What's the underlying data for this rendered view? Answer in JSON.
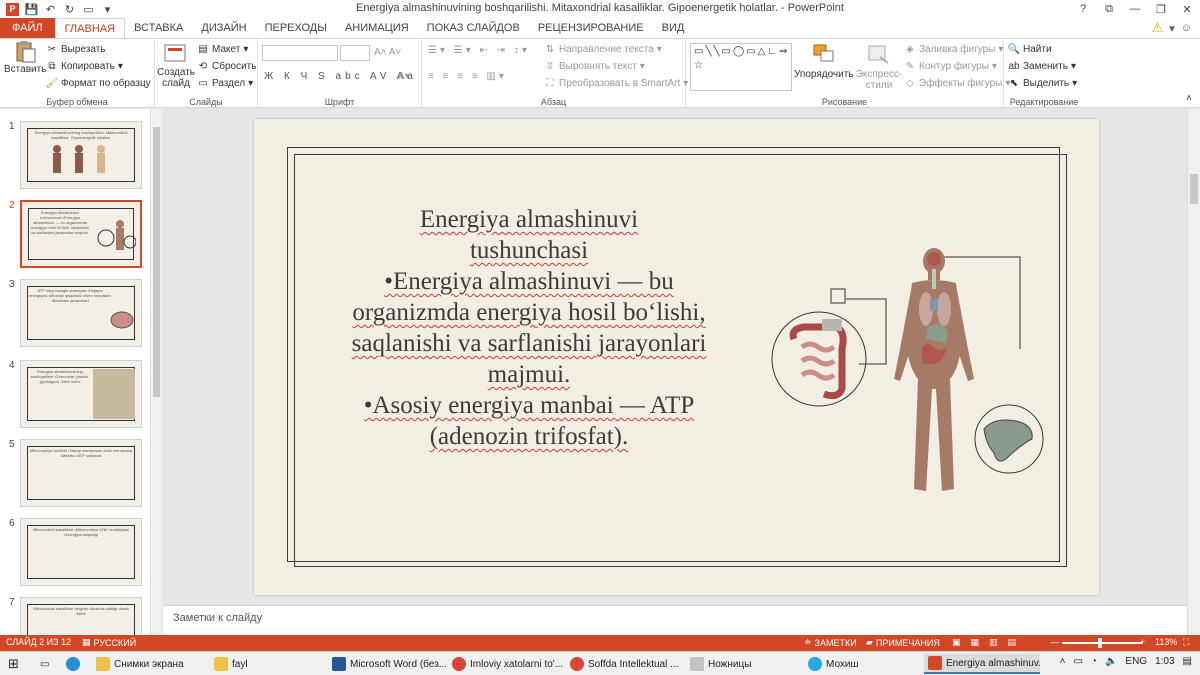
{
  "window": {
    "title": "Energiya almashinuvining boshqarilishi. Mitaxondrial kasalliklar. Gipoenergetik holatlar. - PowerPoint",
    "controls": [
      "?",
      "⧉",
      "—",
      "❐",
      "✕"
    ]
  },
  "tabs": [
    {
      "label": "ФАЙЛ"
    },
    {
      "label": "ГЛАВНАЯ"
    },
    {
      "label": "ВСТАВКА"
    },
    {
      "label": "ДИЗАЙН"
    },
    {
      "label": "ПЕРЕХОДЫ"
    },
    {
      "label": "АНИМАЦИЯ"
    },
    {
      "label": "ПОКАЗ СЛАЙДОВ"
    },
    {
      "label": "РЕЦЕНЗИРОВАНИЕ"
    },
    {
      "label": "ВИД"
    }
  ],
  "ribbon": {
    "clipboard": {
      "label": "Буфер обмена",
      "paste": "Вставить",
      "cut": "Вырезать",
      "copy": "Копировать",
      "format_painter": "Формат по образцу"
    },
    "slides": {
      "label": "Слайды",
      "new_slide": "Создать слайд",
      "layout": "Макет",
      "reset": "Сбросить",
      "section": "Раздел"
    },
    "font": {
      "label": "Шрифт",
      "format_buttons": "Ж К Ч S abc AV Aa"
    },
    "paragraph": {
      "label": "Абзац",
      "text_direction": "Направление текста",
      "align_text": "Выровнять текст",
      "smartart": "Преобразовать в SmartArt"
    },
    "drawing": {
      "label": "Рисование",
      "arrange": "Упорядочить",
      "quick_styles": "Экспресс-стили",
      "shape_fill": "Заливка фигуры",
      "shape_outline": "Контур фигуры",
      "shape_effects": "Эффекты фигуры"
    },
    "editing": {
      "label": "Редактирование",
      "find": "Найти",
      "replace": "Заменить",
      "select": "Выделить"
    }
  },
  "thumbnails": [
    {
      "num": "1",
      "text": "Energiya almashinuvining boshqarilishi. Mitaxondrial kasalliklar. Gipoenergetik holatlar."
    },
    {
      "num": "2",
      "text": "Energiya almashinuvi tushunchasi •Energiya almashinuvi — bu organizmda energiya hosil bo'lishi, saqlanishi va sarflanishi jarayonlari majmui."
    },
    {
      "num": "3",
      "text": "ATP ning biologik ahamiyati •Hujayra energiyasi •Mushak qisqarishi •Nerv impulslari •Biosintez jarayonlari"
    },
    {
      "num": "4",
      "text": "Energiya almashinuvining boshqarilishi •Gormonlar (insulin, glyukagon) •Nerv tizimi"
    },
    {
      "num": "5",
      "text": "Mitoxondriya tuzilishi •Tashqi membrana •Ichki membrana •Matriks •ATP sintazasi"
    },
    {
      "num": "6",
      "text": "Mitoxondrial kasalliklar •Mitoxondriya DNK mutatsiyasi •Energiya tanqisligi"
    },
    {
      "num": "7",
      "text": "Mitoxondrial kasalliklar belgilari •Mushak zaifligi •Asab tizimi"
    }
  ],
  "slide": {
    "title_line1": "Energiya almashinuvi",
    "title_line2": "tushunchasi",
    "bullet1": "•Energiya almashinuvi — bu organizmda energiya hosil bo‘lishi, saqlanishi va sarflanishi jarayonlari majmui.",
    "bullet2": "•Asosiy energiya manbai — ATP (adenozin trifosfat)."
  },
  "notes_placeholder": "Заметки к слайду",
  "status": {
    "slide_info": "СЛАЙД 2 ИЗ 12",
    "language": "РУССКИЙ",
    "notes": "ЗАМЕТКИ",
    "comments": "ПРИМЕЧАНИЯ",
    "zoom": "113%",
    "accent": "#d24726"
  },
  "taskbar": {
    "items": [
      {
        "label": "Снимки экрана"
      },
      {
        "label": "fayl"
      },
      {
        "label": "Microsoft Word (без..."
      },
      {
        "label": "Imloviy xatolarni to'..."
      },
      {
        "label": "Soffda Intellektual ..."
      },
      {
        "label": "Ножницы"
      },
      {
        "label": "Мохиш"
      },
      {
        "label": "Energiya almashinuv..."
      }
    ],
    "lang": "ENG",
    "time": "1:03"
  }
}
